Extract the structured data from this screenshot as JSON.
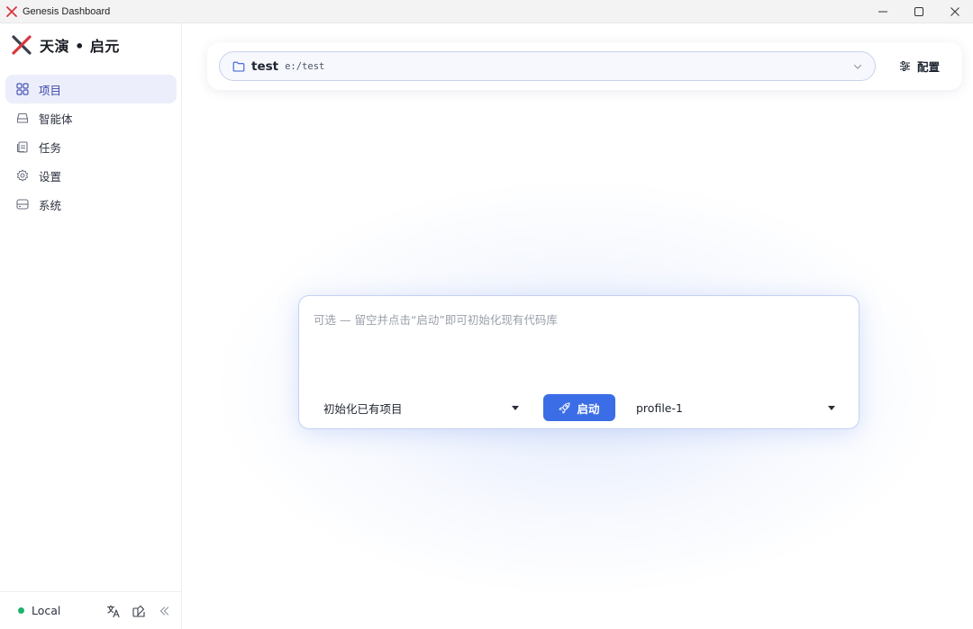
{
  "window": {
    "title": "Genesis Dashboard",
    "controls": [
      "minimize-icon",
      "maximize-icon",
      "close-icon"
    ]
  },
  "brand": {
    "name": "天演 • 启元",
    "logo_color": "#d9363e"
  },
  "sidebar": {
    "items": [
      {
        "label": "项目",
        "icon": "grid-icon",
        "active": true
      },
      {
        "label": "智能体",
        "icon": "inbox-icon",
        "active": false
      },
      {
        "label": "任务",
        "icon": "clipboard-icon",
        "active": false
      },
      {
        "label": "设置",
        "icon": "gear-icon",
        "active": false
      },
      {
        "label": "系统",
        "icon": "server-icon",
        "active": false
      }
    ],
    "footer": {
      "status_label": "Local",
      "status_color": "#1db36b",
      "icons": [
        "translate-icon",
        "theme-icon",
        "collapse-icon"
      ]
    }
  },
  "header": {
    "project_name": "test",
    "project_path": "e:/test",
    "config_label": "配置"
  },
  "composer": {
    "placeholder": "可选 — 留空并点击“启动”即可初始化现有代码库",
    "mode_value": "初始化已有项目",
    "launch_label": "启动",
    "profile_value": "profile-1"
  },
  "colors": {
    "accent": "#3b6ee6",
    "active_nav_bg": "#eceffb"
  }
}
